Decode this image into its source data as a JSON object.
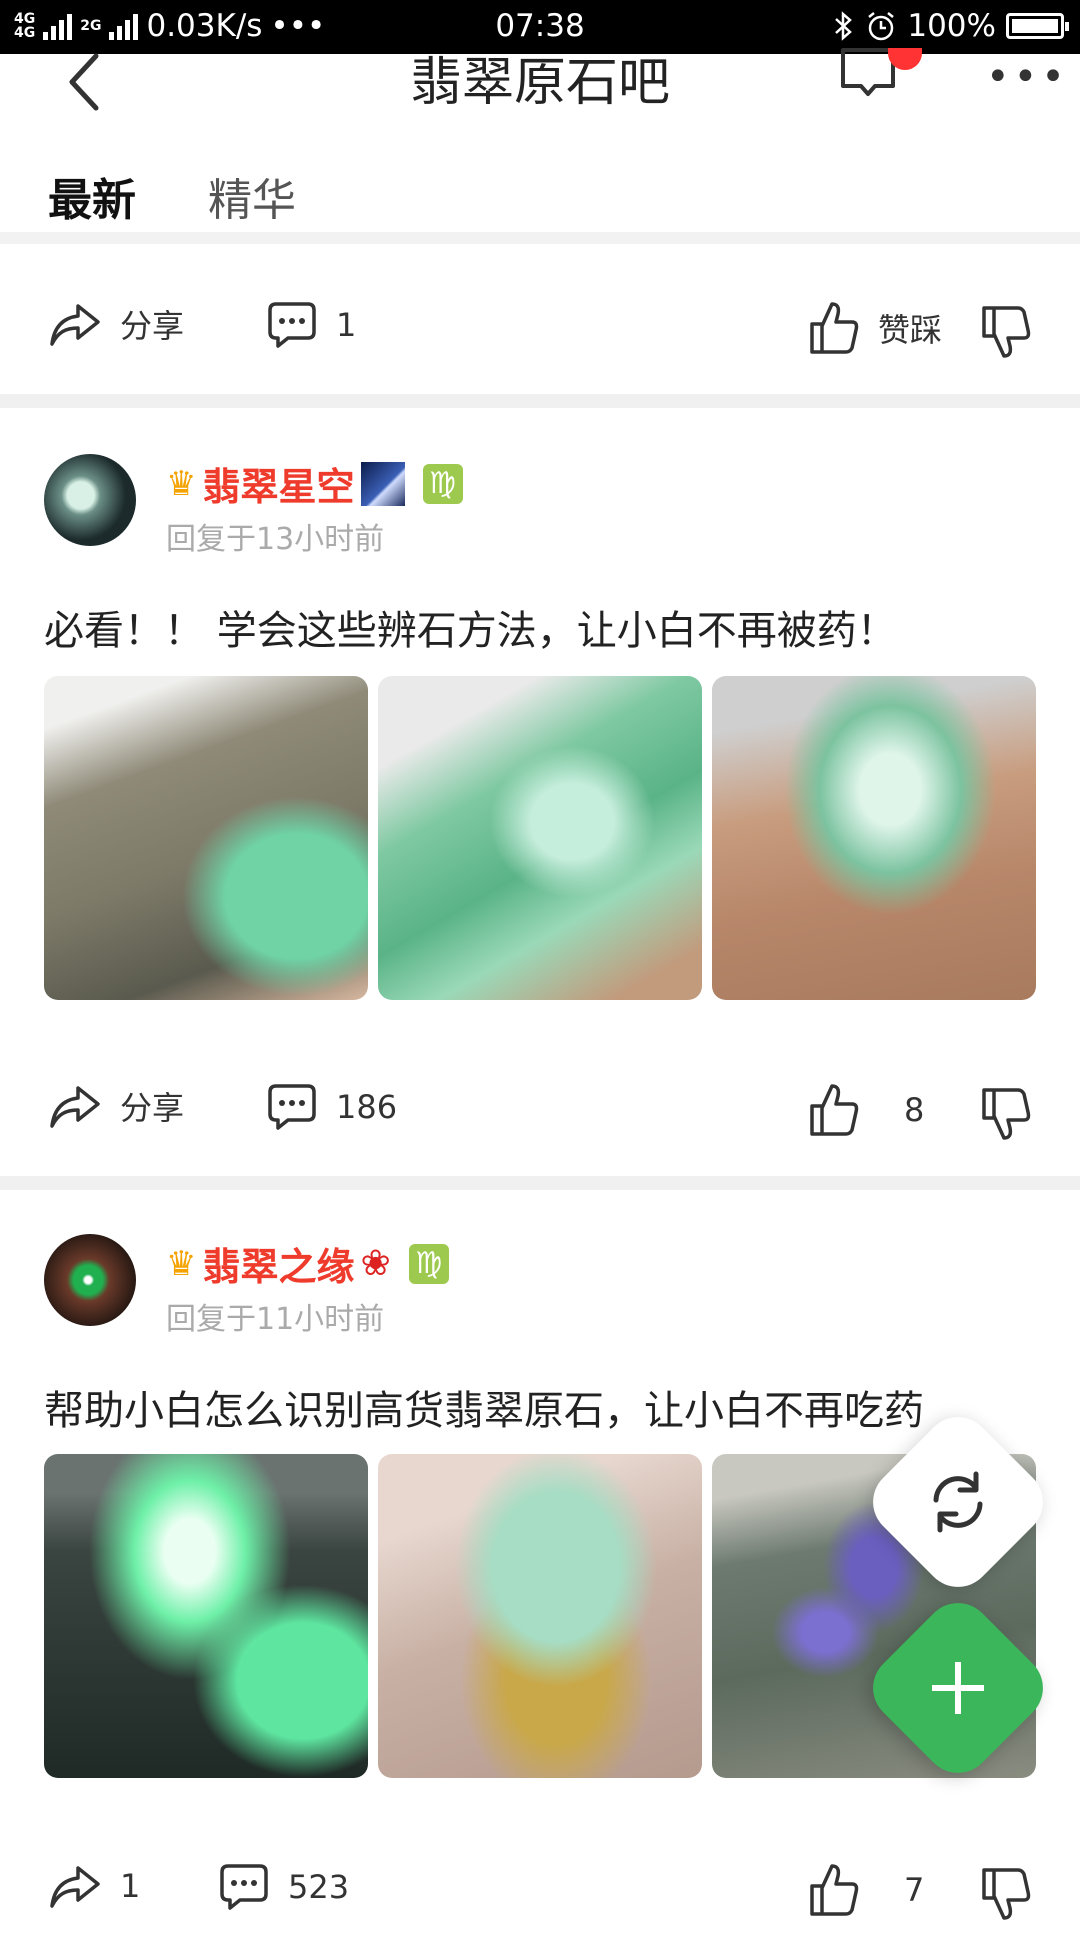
{
  "status_bar": {
    "network_label": "4G 4G 2G",
    "speed": "0.03K/s",
    "dots": "•••",
    "time": "07:38",
    "battery": "100%"
  },
  "header": {
    "title": "翡翠原石吧",
    "tabs": [
      {
        "label": "最新",
        "active": true
      },
      {
        "label": "精华",
        "active": false
      }
    ]
  },
  "top_actions": {
    "share_label": "分享",
    "comment_count": "1",
    "vote_label": "赞踩"
  },
  "posts": [
    {
      "username": "翡翠星空",
      "meta": "回复于13小时前",
      "text": "必看！！ 学会这些辨石方法，让小白不再被药！",
      "share_label": "分享",
      "comment_count": "186",
      "like_count": "8"
    },
    {
      "username": "翡翠之缘",
      "meta": "回复于11小时前",
      "text": "帮助小白怎么识别高货翡翠原石，让小白不再吃药",
      "share_count": "1",
      "comment_count": "523",
      "like_count": "7"
    }
  ],
  "zodiac_symbol": "♍",
  "colors": {
    "username": "#ef3b2c",
    "fab_add": "#3cb65a",
    "zodiac_badge": "#9cc94e"
  }
}
